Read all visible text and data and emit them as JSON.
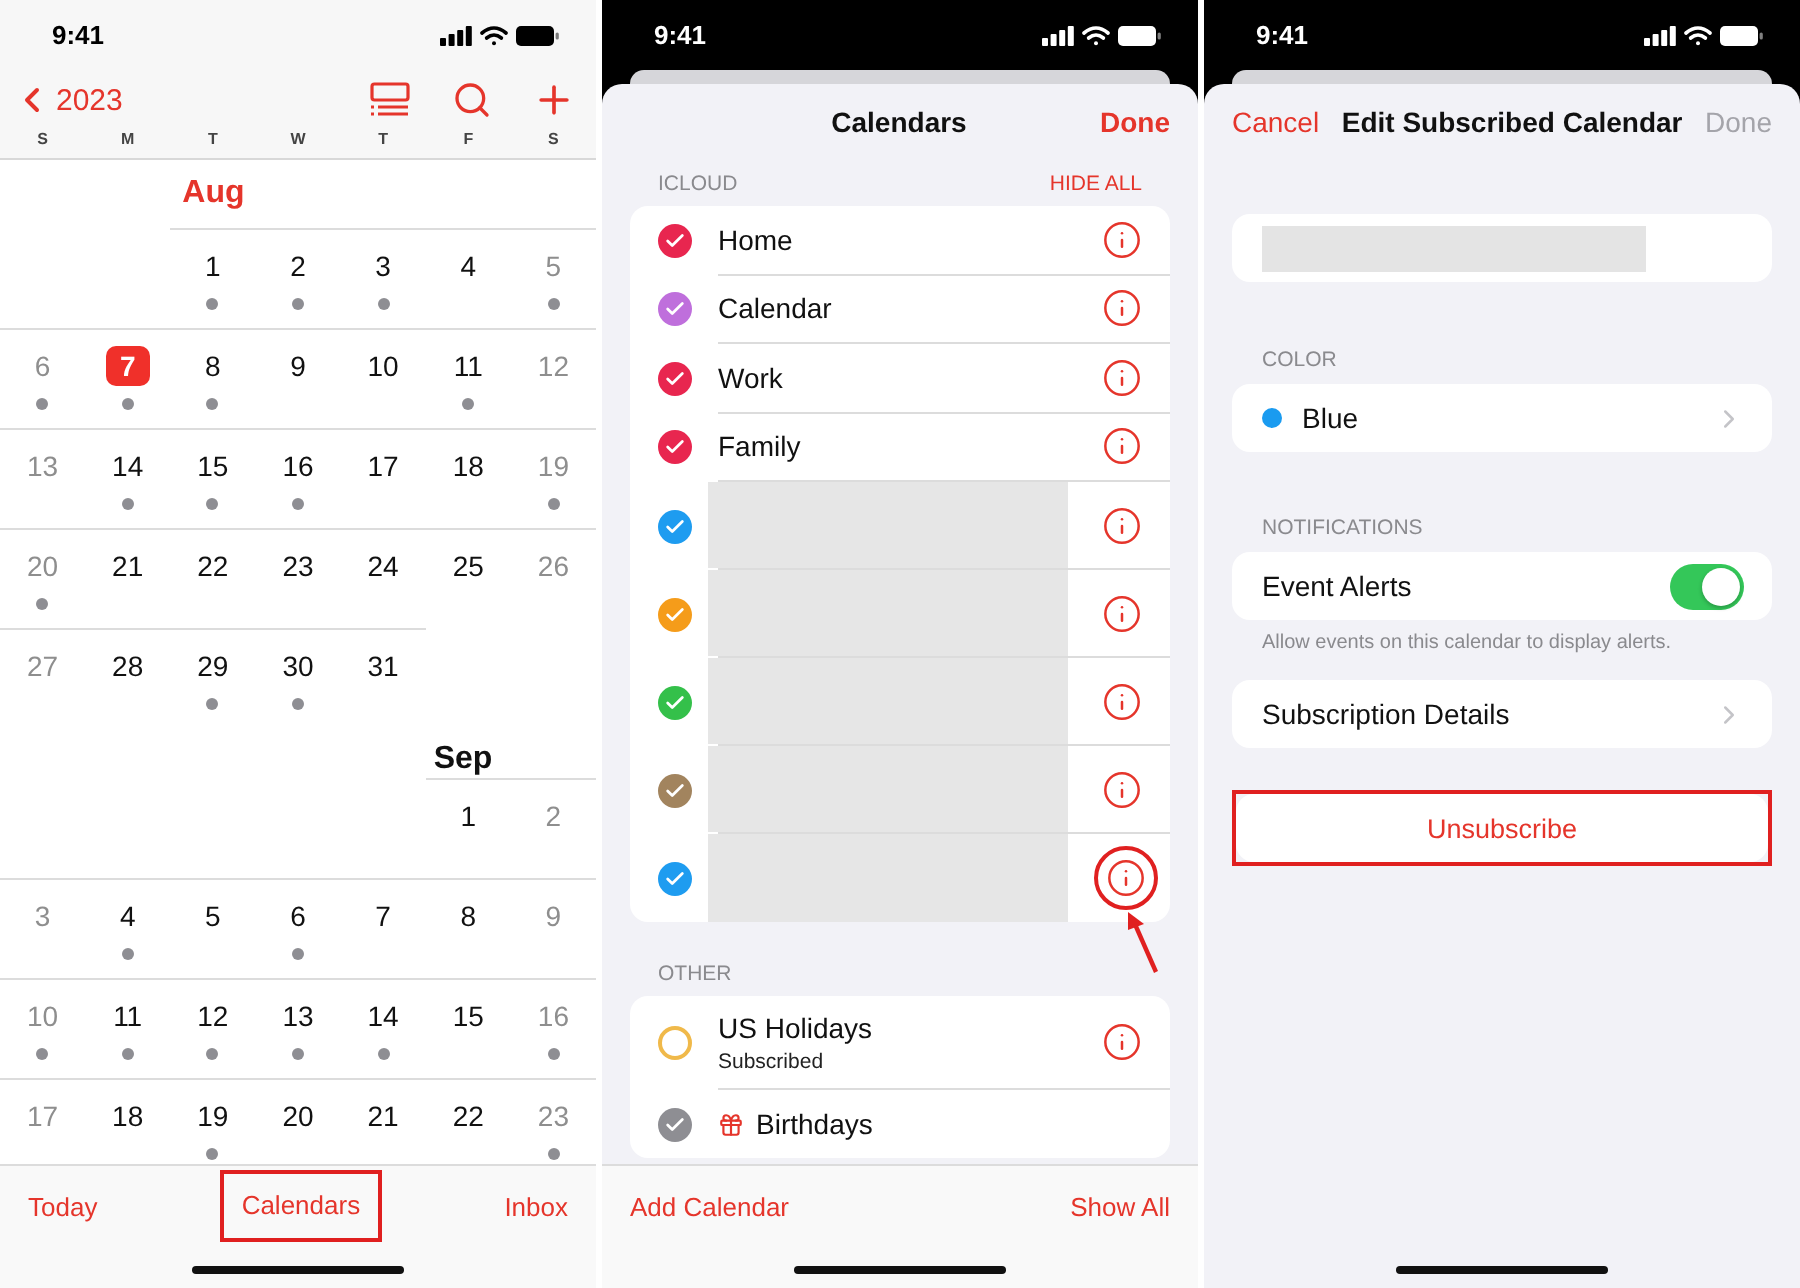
{
  "calendar_screen": {
    "status_time": "9:41",
    "back_label": "2023",
    "weekdays": [
      "S",
      "M",
      "T",
      "W",
      "T",
      "F",
      "S"
    ],
    "rows": [
      {
        "kind": "month",
        "label": "Aug"
      },
      {
        "kind": "week",
        "days": [
          {
            "n": "1",
            "dot": true,
            "today": false
          },
          {
            "n": "2",
            "dot": true,
            "today": false
          },
          {
            "n": "3",
            "dot": true,
            "today": false
          },
          {
            "n": "4",
            "dot": false,
            "today": false
          },
          {
            "n": "5",
            "dot": true,
            "today": false
          }
        ]
      },
      {
        "kind": "week",
        "days": [
          {
            "n": "6",
            "dot": true,
            "today": false
          },
          {
            "n": "7",
            "dot": true,
            "today": true
          },
          {
            "n": "8",
            "dot": true,
            "today": false
          },
          {
            "n": "9",
            "dot": false,
            "today": false
          },
          {
            "n": "10",
            "dot": false,
            "today": false
          },
          {
            "n": "11",
            "dot": true,
            "today": false
          },
          {
            "n": "12",
            "dot": false,
            "today": false
          }
        ]
      },
      {
        "kind": "week",
        "days": [
          {
            "n": "13",
            "dot": false,
            "today": false
          },
          {
            "n": "14",
            "dot": true,
            "today": false
          },
          {
            "n": "15",
            "dot": true,
            "today": false
          },
          {
            "n": "16",
            "dot": true,
            "today": false
          },
          {
            "n": "17",
            "dot": false,
            "today": false
          },
          {
            "n": "18",
            "dot": false,
            "today": false
          },
          {
            "n": "19",
            "dot": true,
            "today": false
          }
        ]
      },
      {
        "kind": "week",
        "days": [
          {
            "n": "20",
            "dot": true,
            "today": false
          },
          {
            "n": "21",
            "dot": false,
            "today": false
          },
          {
            "n": "22",
            "dot": false,
            "today": false
          },
          {
            "n": "23",
            "dot": false,
            "today": false
          },
          {
            "n": "24",
            "dot": false,
            "today": false
          },
          {
            "n": "25",
            "dot": false,
            "today": false
          },
          {
            "n": "26",
            "dot": false,
            "today": false
          }
        ]
      },
      {
        "kind": "week",
        "days": [
          {
            "n": "27",
            "dot": false,
            "today": false
          },
          {
            "n": "28",
            "dot": false,
            "today": false
          },
          {
            "n": "29",
            "dot": true,
            "today": false
          },
          {
            "n": "30",
            "dot": true,
            "today": false
          },
          {
            "n": "31",
            "dot": false,
            "today": false
          }
        ]
      },
      {
        "kind": "month",
        "label": "Sep"
      },
      {
        "kind": "week",
        "days": [
          {
            "n": "1",
            "dot": false,
            "today": false
          },
          {
            "n": "2",
            "dot": false,
            "today": false
          }
        ]
      },
      {
        "kind": "week",
        "days": [
          {
            "n": "3",
            "dot": false,
            "today": false
          },
          {
            "n": "4",
            "dot": true,
            "today": false
          },
          {
            "n": "5",
            "dot": false,
            "today": false
          },
          {
            "n": "6",
            "dot": true,
            "today": false
          },
          {
            "n": "7",
            "dot": false,
            "today": false
          },
          {
            "n": "8",
            "dot": false,
            "today": false
          },
          {
            "n": "9",
            "dot": false,
            "today": false
          }
        ]
      },
      {
        "kind": "week",
        "days": [
          {
            "n": "10",
            "dot": true,
            "today": false
          },
          {
            "n": "11",
            "dot": true,
            "today": false
          },
          {
            "n": "12",
            "dot": true,
            "today": false
          },
          {
            "n": "13",
            "dot": true,
            "today": false
          },
          {
            "n": "14",
            "dot": true,
            "today": false
          },
          {
            "n": "15",
            "dot": false,
            "today": false
          },
          {
            "n": "16",
            "dot": true,
            "today": false
          }
        ]
      },
      {
        "kind": "week",
        "days": [
          {
            "n": "17",
            "dot": false,
            "today": false
          },
          {
            "n": "18",
            "dot": false,
            "today": false
          },
          {
            "n": "19",
            "dot": true,
            "today": false
          },
          {
            "n": "20",
            "dot": false,
            "today": false
          },
          {
            "n": "21",
            "dot": false,
            "today": false
          },
          {
            "n": "22",
            "dot": false,
            "today": false
          },
          {
            "n": "23",
            "dot": true,
            "today": false
          }
        ]
      }
    ],
    "toolbar": [
      {
        "label": "Today",
        "annotated": false
      },
      {
        "label": "Calendars",
        "annotated": true
      },
      {
        "label": "Inbox",
        "annotated": false
      }
    ]
  },
  "calendars_screen": {
    "status_time": "9:41",
    "title": "Calendars",
    "done": "Done",
    "sections": [
      {
        "header": "ICLOUD",
        "action": "HIDE ALL",
        "items": [
          {
            "kind": "named",
            "name": "Home",
            "checked": true,
            "color": "#e8264f",
            "annotated": false
          },
          {
            "kind": "named",
            "name": "Calendar",
            "checked": true,
            "color": "#bf6fdc",
            "annotated": false
          },
          {
            "kind": "named",
            "name": "Work",
            "checked": true,
            "color": "#e8264f",
            "annotated": false
          },
          {
            "kind": "named",
            "name": "Family",
            "checked": true,
            "color": "#e8264f",
            "annotated": false
          },
          {
            "kind": "redacted",
            "checked": true,
            "color": "#1e9cf0",
            "annotated": false
          },
          {
            "kind": "redacted",
            "checked": true,
            "color": "#f59c1a",
            "annotated": false
          },
          {
            "kind": "redacted",
            "checked": true,
            "color": "#34c04a",
            "annotated": false
          },
          {
            "kind": "redacted",
            "checked": true,
            "color": "#a2845e",
            "annotated": false
          },
          {
            "kind": "redacted",
            "checked": true,
            "color": "#1e9cf0",
            "annotated": true
          }
        ]
      },
      {
        "header": "OTHER",
        "items": [
          {
            "kind": "subscribed",
            "name": "US Holidays",
            "subtitle": "Subscribed",
            "checked": false,
            "color": "#f0b94a",
            "annotated": false
          },
          {
            "kind": "birthdays",
            "name": "Birthdays",
            "checked": true,
            "color": "#8e8e93",
            "annotated": false
          }
        ]
      }
    ],
    "footer": [
      "Add Calendar",
      "Show All"
    ]
  },
  "edit_screen": {
    "status_time": "9:41",
    "cancel": "Cancel",
    "title": "Edit Subscribed Calendar",
    "done": {
      "label": "Done",
      "disabled": true
    },
    "color_header": "COLOR",
    "color_choice": {
      "name": "Blue",
      "color": "#1a9bf0"
    },
    "notifications_header": "NOTIFICATIONS",
    "event_alerts": {
      "label": "Event Alerts",
      "on": true
    },
    "alerts_note": "Allow events on this calendar to display alerts.",
    "subscription_details": "Subscription Details",
    "unsubscribe": {
      "label": "Unsubscribe",
      "annotated": true
    }
  }
}
